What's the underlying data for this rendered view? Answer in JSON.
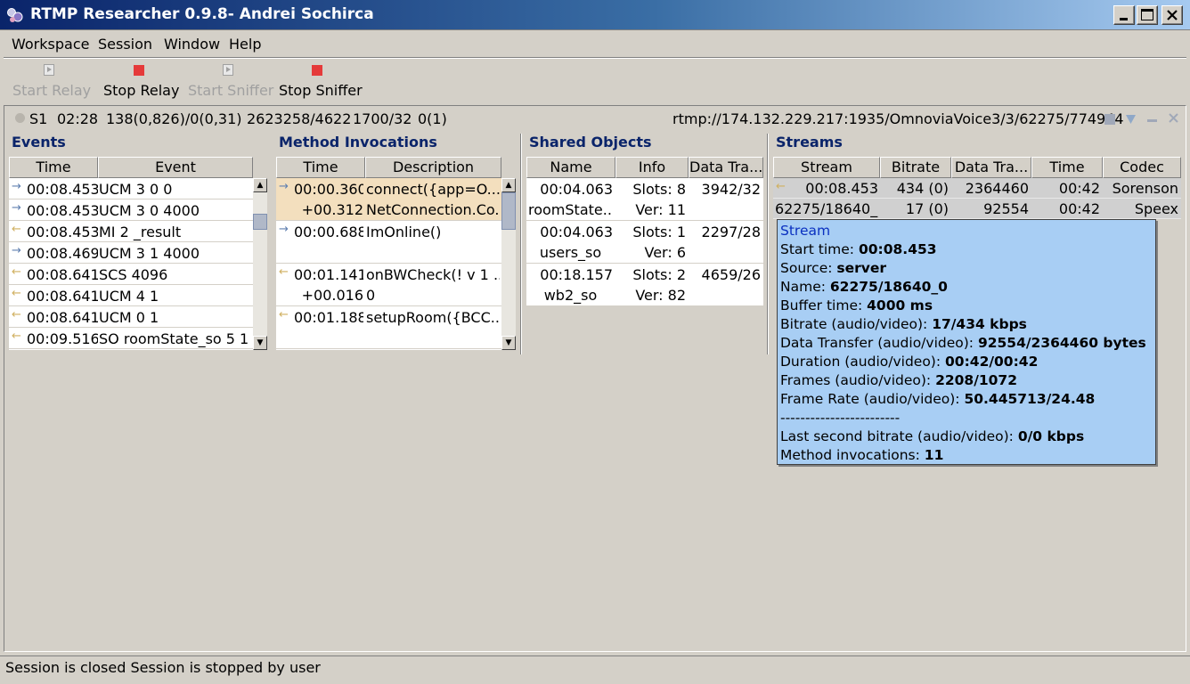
{
  "window": {
    "title": "RTMP Researcher 0.9.8- Andrei Sochirca",
    "minimize": "_",
    "maximize": "□",
    "close": "✕"
  },
  "menu": [
    "Workspace",
    "Session",
    "Window",
    "Help"
  ],
  "toolbar": {
    "start_relay": "Start Relay",
    "stop_relay": "Stop Relay",
    "start_sniffer": "Start Sniffer",
    "stop_sniffer": "Stop Sniffer"
  },
  "session": {
    "id": "S1",
    "duration": "02:28",
    "packets": "138(0,826)/0(0,31)",
    "bytes": "2623258/4622",
    "rate": "1700/32",
    "errors": "0(1)",
    "url": "rtmp://174.132.229.217:1935/OmnoviaVoice3/3/62275/774944"
  },
  "events": {
    "title": "Events",
    "headers": [
      "Time",
      "Event"
    ],
    "rows": [
      {
        "dir": "→",
        "time": "00:08.453",
        "event": "UCM 3 0 0"
      },
      {
        "dir": "→",
        "time": "00:08.453",
        "event": "UCM 3 0 4000"
      },
      {
        "dir": "←",
        "time": "00:08.453",
        "event": "MI 2 _result"
      },
      {
        "dir": "→",
        "time": "00:08.469",
        "event": "UCM 3 1 4000"
      },
      {
        "dir": "←",
        "time": "00:08.641",
        "event": "SCS 4096"
      },
      {
        "dir": "←",
        "time": "00:08.641",
        "event": "UCM 4 1"
      },
      {
        "dir": "←",
        "time": "00:08.641",
        "event": "UCM 0 1"
      },
      {
        "dir": "←",
        "time": "00:09.516",
        "event": "SO roomState_so 5 1"
      }
    ]
  },
  "methods": {
    "title": "Method Invocations",
    "headers": [
      "Time",
      "Description"
    ],
    "rows": [
      {
        "dir": "→",
        "time": "00:00.360",
        "time2": "+00.312",
        "desc": "connect({app=O...",
        "desc2": "NetConnection.Co..."
      },
      {
        "dir": "→",
        "time": "00:00.688",
        "time2": "",
        "desc": "ImOnline()",
        "desc2": ""
      },
      {
        "dir": "←",
        "time": "00:01.141",
        "time2": "+00.016",
        "desc": "onBWCheck(! v 1 ...",
        "desc2": "0"
      },
      {
        "dir": "←",
        "time": "00:01.188",
        "time2": "",
        "desc": "setupRoom({BCC...",
        "desc2": ""
      }
    ]
  },
  "shared": {
    "title": "Shared Objects",
    "headers": [
      "Name",
      "Info",
      "Data Tra..."
    ],
    "rows": [
      {
        "time": "00:04.063",
        "name": "roomState...",
        "slots": "Slots: 8",
        "ver": "Ver: 11",
        "data": "3942/32"
      },
      {
        "time": "00:04.063",
        "name": "users_so",
        "slots": "Slots: 1",
        "ver": "Ver: 6",
        "data": "2297/28"
      },
      {
        "time": "00:18.157",
        "name": "wb2_so",
        "slots": "Slots: 2",
        "ver": "Ver: 82",
        "data": "4659/26"
      }
    ]
  },
  "streams": {
    "title": "Streams",
    "headers": [
      "Stream",
      "Bitrate",
      "Data Tra...",
      "Time",
      "Codec"
    ],
    "rows": [
      {
        "dir": "←",
        "stream": "00:08.453",
        "bitrate": "434 (0)",
        "data": "2364460",
        "time": "00:42",
        "codec": "Sorenson"
      },
      {
        "dir": "",
        "stream": "62275/18640_0",
        "bitrate": "17 (0)",
        "data": "92554",
        "time": "00:42",
        "codec": "Speex"
      }
    ]
  },
  "tooltip": {
    "title": "Stream",
    "lines": [
      {
        "label": "Start time: ",
        "value": "00:08.453"
      },
      {
        "label": "Source: ",
        "value": "server"
      },
      {
        "label": "Name: ",
        "value": "62275/18640_0"
      },
      {
        "label": "Buffer time: ",
        "value": "4000 ms"
      },
      {
        "label": "Bitrate (audio/video): ",
        "value": "17/434 kbps"
      },
      {
        "label": "Data Transfer (audio/video): ",
        "value": "92554/2364460 bytes"
      },
      {
        "label": "Duration (audio/video): ",
        "value": "00:42/00:42"
      },
      {
        "label": "Frames (audio/video): ",
        "value": "2208/1072"
      },
      {
        "label": "Frame Rate (audio/video): ",
        "value": "50.445713/24.48"
      }
    ],
    "separator": "------------------------",
    "lines2": [
      {
        "label": "Last second bitrate (audio/video): ",
        "value": "0/0 kbps"
      },
      {
        "label": "Method invocations: ",
        "value": "11"
      }
    ]
  },
  "status": "Session is closed Session is stopped by user"
}
